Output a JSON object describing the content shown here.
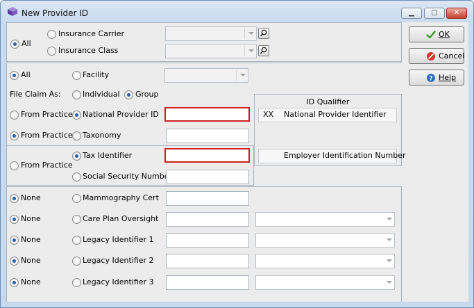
{
  "window": {
    "title": "New Provider ID",
    "controls": {
      "minimize": "▁",
      "maximize": "▢",
      "close": "✕"
    }
  },
  "scope": {
    "all_label": "All",
    "insurance_carrier_label": "Insurance Carrier",
    "insurance_class_label": "Insurance Class",
    "carrier_value": "",
    "class_value": ""
  },
  "facility_row": {
    "all_label": "All",
    "facility_label": "Facility",
    "facility_value": ""
  },
  "file_claim": {
    "label": "File Claim As:",
    "individual_label": "Individual",
    "group_label": "Group"
  },
  "npi_row": {
    "source_label": "From Practice",
    "id_label": "National Provider ID",
    "value": ""
  },
  "taxonomy_row": {
    "source_label": "From Practice",
    "id_label": "Taxonomy",
    "value": ""
  },
  "tax_group": {
    "source_label": "From Practice",
    "tax_id_label": "Tax Identifier",
    "ssn_label": "Social Security Number",
    "tax_value": "",
    "ssn_value": ""
  },
  "id_qualifier": {
    "title": "ID Qualifier",
    "npi_code": "XX",
    "npi_desc": "National Provider Identifier",
    "ein_desc": "Employer Identification Number"
  },
  "other_ids": [
    {
      "source_label": "None",
      "id_label": "Mammography Cert",
      "has_combo": false
    },
    {
      "source_label": "None",
      "id_label": "Care Plan Oversight",
      "has_combo": true
    },
    {
      "source_label": "None",
      "id_label": "Legacy Identifier 1",
      "has_combo": true
    },
    {
      "source_label": "None",
      "id_label": "Legacy Identifier 2",
      "has_combo": true
    },
    {
      "source_label": "None",
      "id_label": "Legacy Identifier 3",
      "has_combo": true
    }
  ],
  "buttons": {
    "ok": {
      "label": "OK",
      "mnemonic": "O",
      "icon": "checkmark-icon"
    },
    "cancel": {
      "label": "Cancel",
      "icon": "cancel-icon"
    },
    "help": {
      "label": "Help",
      "mnemonic": "H",
      "icon": "help-icon"
    }
  },
  "colors": {
    "accent": "#2a5ea8",
    "required_border": "#d02020",
    "client_bg": "#ececec"
  }
}
